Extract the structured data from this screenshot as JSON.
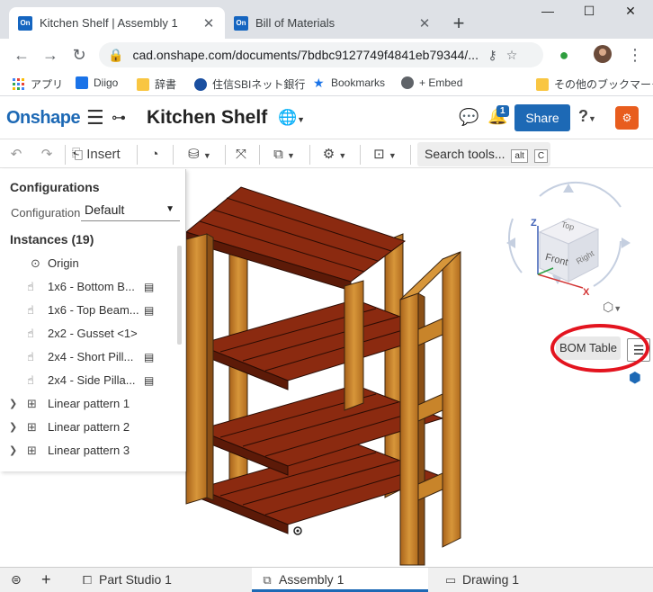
{
  "browser": {
    "tabs": [
      {
        "title": "Kitchen Shelf | Assembly 1",
        "favicon": "On",
        "active": true
      },
      {
        "title": "Bill of Materials",
        "favicon": "On",
        "active": false
      }
    ],
    "window_controls": [
      "minimize",
      "maximize",
      "close"
    ],
    "url": "cad.onshape.com/documents/7bdbc9127749f4841eb79344/...",
    "bookmarks": [
      {
        "label": "アプリ",
        "icon": "apps-grid-icon"
      },
      {
        "label": "Diigo",
        "icon": "diigo-icon"
      },
      {
        "label": "辞書",
        "icon": "folder-icon"
      },
      {
        "label": "住信SBIネット銀行",
        "icon": "bank-icon"
      },
      {
        "label": "Bookmarks",
        "icon": "star-icon"
      },
      {
        "label": "+ Embed",
        "icon": "globe-icon"
      },
      {
        "label": "その他のブックマーク",
        "icon": "folder-icon"
      }
    ]
  },
  "onshape": {
    "logo": "Onshape",
    "document_title": "Kitchen Shelf",
    "notification_count": "1",
    "share_label": "Share",
    "toolbar": {
      "insert_label": "Insert",
      "search_label": "Search tools...",
      "search_key1": "alt",
      "search_key2": "C"
    },
    "panel": {
      "configurations_heading": "Configurations",
      "configuration_label": "Configuration",
      "configuration_value": "Default",
      "instances_heading": "Instances (19)",
      "instances": [
        {
          "label": "Origin",
          "icon": "origin-icon",
          "expandable": false
        },
        {
          "label": "1x6 - Bottom B...",
          "icon": "part-instance-icon",
          "expandable": false
        },
        {
          "label": "1x6 - Top Beam...",
          "icon": "part-instance-icon",
          "expandable": false
        },
        {
          "label": "2x2 - Gusset <1>",
          "icon": "part-instance-icon",
          "expandable": false
        },
        {
          "label": "2x4 - Short Pill...",
          "icon": "part-instance-icon",
          "expandable": false
        },
        {
          "label": "2x4 - Side Pilla...",
          "icon": "part-instance-icon",
          "expandable": false
        },
        {
          "label": "Linear pattern 1",
          "icon": "pattern-icon",
          "expandable": true
        },
        {
          "label": "Linear pattern 2",
          "icon": "pattern-icon",
          "expandable": true
        },
        {
          "label": "Linear pattern 3",
          "icon": "pattern-icon",
          "expandable": true
        }
      ]
    },
    "view_cube": {
      "face_top": "Top",
      "face_front": "Front",
      "face_right": "Right",
      "axis_z": "Z",
      "axis_x": "X"
    },
    "bom_table_label": "BOM Table",
    "bottom_tabs": [
      {
        "label": "Part Studio 1",
        "icon": "part-studio-icon",
        "active": false
      },
      {
        "label": "Assembly 1",
        "icon": "assembly-icon",
        "active": true
      },
      {
        "label": "Drawing 1",
        "icon": "drawing-icon",
        "active": false
      }
    ]
  },
  "colors": {
    "brand": "#1d69b5",
    "wood_pillar": "#c8842a",
    "wood_shelf": "#8b2a10",
    "highlight_ring": "#e3141f"
  }
}
